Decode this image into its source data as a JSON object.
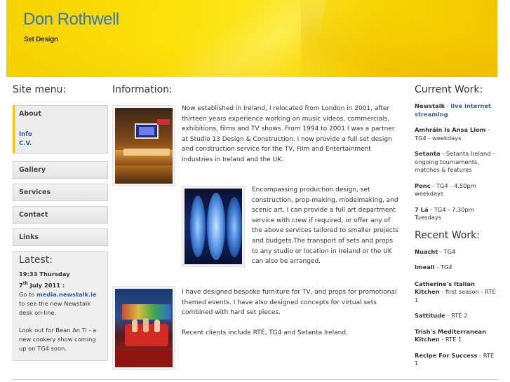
{
  "header": {
    "title": "Don Rothwell",
    "subtitle": "Set Design"
  },
  "sidebar": {
    "heading": "Site menu:",
    "about": {
      "label": "About",
      "subitems": [
        "Info",
        "C.V."
      ]
    },
    "items": [
      {
        "label": "Gallery"
      },
      {
        "label": "Services"
      },
      {
        "label": "Contact"
      },
      {
        "label": "Links"
      }
    ]
  },
  "latest": {
    "heading": "Latest:",
    "time": "19:33 Thursday",
    "date_day": "7",
    "date_suffix": "th",
    "date_rest": " July 2011 :",
    "text1_pre": "Go to ",
    "text1_link": "media.newstalk.ie",
    "text1_post": " to see the new Newstalk desk on-line.",
    "text2": "Look out for Bean An Ti - a new cookery show coming up on TG4 soon."
  },
  "main": {
    "heading": "Information:",
    "paragraph1": "Now established in Ireland, I relocated from London in 2001, after thirteen years experience working on music videos, commercials, exhibitions, films and TV shows. From 1994 to 2001 I was a partner at Studio 13 Design & Construction. I now provide a full set design and construction service for the TV, Film and Entertainment industries in Ireland and the UK.",
    "paragraph2": "Encompassing production design, set construction, prop-making, modelmaking, and scenic art, I can provide a full art department service with crew if required, or offer any of the above services tailored to smaller projects and budgets.The transport of sets and props to any studio or location in Ireland or the UK can also be arranged.",
    "paragraph3": "I have designed bespoke furniture for TV, and props for promotional themed events. I have also designed concepts for virtual sets combined with hard set pieces.",
    "paragraph4": "Recent clients include RTÉ, TG4 and Setanta Ireland."
  },
  "current_work": {
    "heading": "Current Work:",
    "items": [
      {
        "title": "Newstalk",
        "sep": " - ",
        "link": "live internet streaming",
        "detail": ""
      },
      {
        "title": "Amhráin Is Ansa Liom",
        "sep": " - ",
        "link": "",
        "detail": "TG4 - weekdays"
      },
      {
        "title": "Setanta",
        "sep": " - ",
        "link": "",
        "detail": "Setanta Ireland - ongoing tournaments, matches & features"
      },
      {
        "title": "Ponc",
        "sep": " - ",
        "link": "",
        "detail": "TG4 - 4.50pm weekdays"
      },
      {
        "title": "7 Lá",
        "sep": " - ",
        "link": "",
        "detail": "TG4 - 7.30pm Tuesdays"
      }
    ]
  },
  "recent_work": {
    "heading": "Recent Work:",
    "items": [
      {
        "title": "Nuacht",
        "detail": " - TG4"
      },
      {
        "title": "Imeall",
        "detail": " - TG4"
      },
      {
        "title": "Catherine's Italian Kitchen",
        "detail": " - first season - RTÉ 1"
      },
      {
        "title": "Sattitude",
        "detail": " - RTÉ 2"
      },
      {
        "title": "Trish's Mediterranean Kitchen",
        "detail": " - RTÉ 1"
      },
      {
        "title": "Recipe For Success",
        "detail": " - RTÉ 1"
      }
    ]
  },
  "colors": {
    "accent": "#f5c400",
    "link": "#2d5fa0",
    "title": "#3a78b4"
  }
}
